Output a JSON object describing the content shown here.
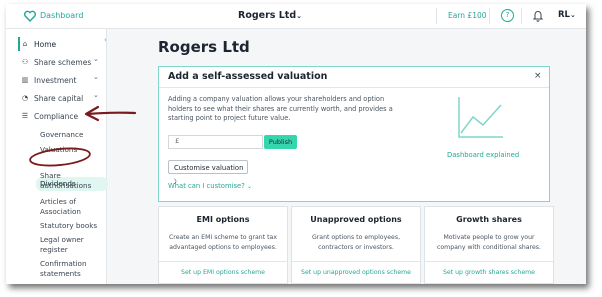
{
  "topbar": {
    "dashboard_label": "Dashboard",
    "company": "Rogers Ltd",
    "company_chevron": "⌄",
    "earn": "Earn £100",
    "help_icon": "?",
    "user_initials": "RL",
    "user_chevron": "⌄"
  },
  "sidebar": {
    "collapse_glyph": "‹",
    "items": [
      {
        "label": "Home",
        "icon": "home-icon",
        "glyph": "⌂"
      },
      {
        "label": "Share schemes",
        "icon": "people-icon",
        "glyph": "⚇"
      },
      {
        "label": "Investment",
        "icon": "bank-icon",
        "glyph": "▥"
      },
      {
        "label": "Share capital",
        "icon": "pie-icon",
        "glyph": "◔"
      },
      {
        "label": "Compliance",
        "icon": "list-icon",
        "glyph": "☰"
      }
    ],
    "chevron": "⌄",
    "compliance_sub": [
      "Governance",
      "Valuations",
      "Dividends",
      "Share authorisations",
      "Articles of Association",
      "Statutory books",
      "Legal owner register",
      "Confirmation statements"
    ]
  },
  "main": {
    "title": "Rogers Ltd",
    "valuation": {
      "title": "Add a self-assessed valuation",
      "close": "×",
      "description": "Adding a company valuation allows your shareholders and option holders to see what their shares are currently worth, and provides a starting point to project future value.",
      "currency": "£",
      "publish": "Publish",
      "customise": "Customise valuation",
      "customise_chevron": "〉",
      "customise_link": "What can I customise?",
      "link_chevron": "⌄",
      "dashboard_explained": "Dashboard explained"
    },
    "options": [
      {
        "title": "EMI options",
        "desc": "Create an EMI scheme to grant tax advantaged options to employees.",
        "link": "Set up EMI options scheme"
      },
      {
        "title": "Unapproved options",
        "desc": "Grant options to employees, contractors or investors.",
        "link": "Set up unapproved options scheme"
      },
      {
        "title": "Growth shares",
        "desc": "Motivate people to grow your company with conditional shares.",
        "link": "Set up growth shares scheme"
      }
    ]
  },
  "colors": {
    "accent": "#24a896",
    "publish": "#35d6ae",
    "annotation": "#7a1a1f"
  }
}
